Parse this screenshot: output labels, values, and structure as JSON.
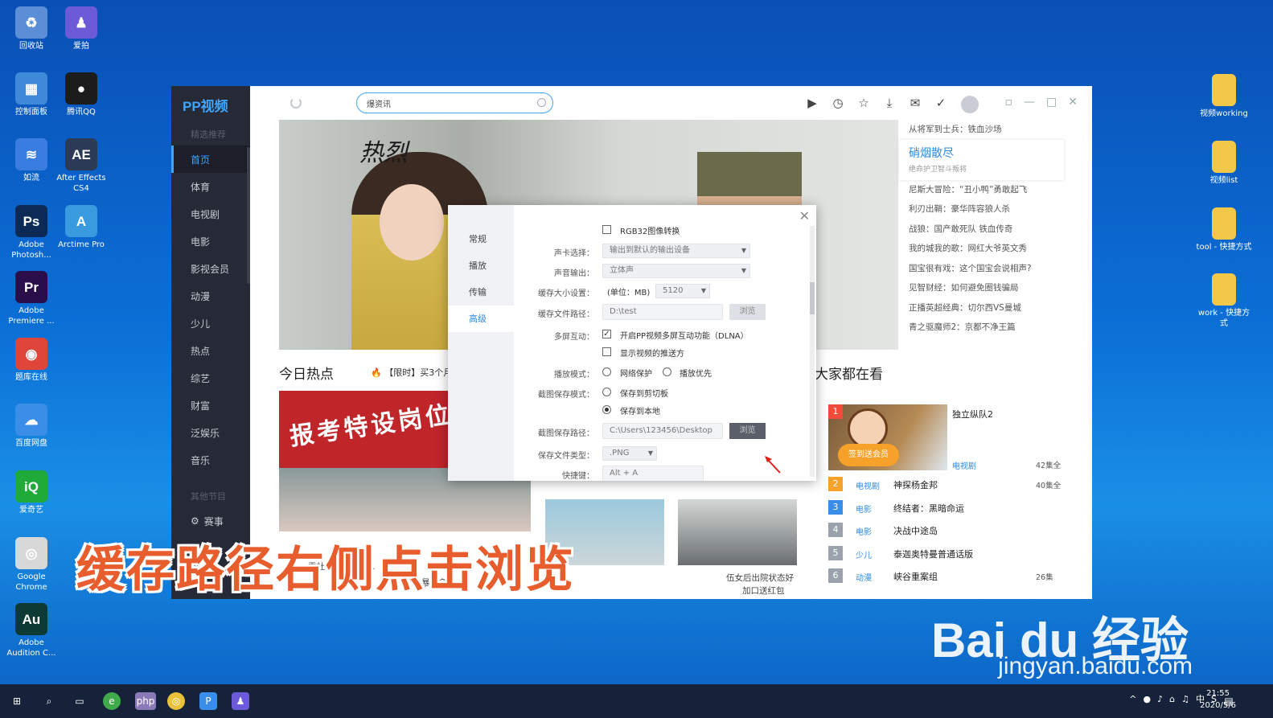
{
  "desktop": {
    "left_icons": [
      {
        "label": "回收站",
        "icon": "recycle-bin-icon",
        "color": "#5a8fd8",
        "glyph": "♻"
      },
      {
        "label": "爱拍",
        "icon": "aipai-icon",
        "color": "#6b5bd8",
        "glyph": "♟"
      },
      {
        "label": "控制面板",
        "icon": "control-panel-icon",
        "color": "#3f8ad8",
        "glyph": "▦"
      },
      {
        "label": "腾讯QQ",
        "icon": "qq-icon",
        "color": "#1c1c1c",
        "glyph": "●"
      },
      {
        "label": "如流",
        "icon": "ruliu-icon",
        "color": "#3a7de0",
        "glyph": "≋"
      },
      {
        "label": "After Effects CS4",
        "icon": "after-effects-icon",
        "color": "#2b3a55",
        "glyph": "AE"
      },
      {
        "label": "Adobe Photosh...",
        "icon": "photoshop-icon",
        "color": "#0c2a55",
        "glyph": "Ps"
      },
      {
        "label": "Arctime Pro",
        "icon": "arctime-icon",
        "color": "#3a9ae0",
        "glyph": "A"
      },
      {
        "label": "Adobe Premiere ...",
        "icon": "premiere-icon",
        "color": "#2a0e4a",
        "glyph": "Pr"
      },
      {
        "label": "题库在线",
        "icon": "tiku-icon",
        "color": "#e0453a",
        "glyph": "◉"
      },
      {
        "label": "百度网盘",
        "icon": "baidu-netdisk-icon",
        "color": "#3a8ee8",
        "glyph": "☁"
      },
      {
        "label": "爱奇艺",
        "icon": "iqiyi-icon",
        "color": "#1faa3a",
        "glyph": "iQ"
      },
      {
        "label": "Google Chrome",
        "icon": "chrome-icon",
        "color": "#d8d8d8",
        "glyph": "◎"
      },
      {
        "label": "Adobe Audition C...",
        "icon": "audition-icon",
        "color": "#0d3a35",
        "glyph": "Au"
      }
    ],
    "right_icons": [
      {
        "label": "视频working",
        "icon": "folder-icon"
      },
      {
        "label": "视频list",
        "icon": "folder-icon"
      },
      {
        "label": "tool - 快捷方式",
        "icon": "folder-shortcut-icon"
      },
      {
        "label": "work - 快捷方式",
        "icon": "folder-shortcut-icon"
      }
    ]
  },
  "app": {
    "logo": "PP视频",
    "nav_section_top": "精选推荐",
    "nav_items": [
      "首页",
      "体育",
      "电视剧",
      "电影",
      "影视会员",
      "动漫",
      "少儿",
      "热点",
      "综艺",
      "财富",
      "泛娱乐",
      "音乐"
    ],
    "nav_section_bottom": "其他节目",
    "nav_bottom_item": "赛事",
    "search_value": "爆资讯",
    "hero_title": "热烈",
    "hot_list": [
      {
        "text": "从将军到士兵：铁血沙场"
      },
      {
        "featured": true,
        "title": "硝烟散尽",
        "sub": "绝命护卫智斗叛将"
      },
      {
        "text": "尼斯大冒险：“丑小鸭”勇敢起飞"
      },
      {
        "text": "利刃出鞘：豪华阵容狼人杀"
      },
      {
        "text": "战狼：国产敢死队 铁血传奇"
      },
      {
        "text": "我的城我的歌：网红大爷英文秀"
      },
      {
        "text": "国宝很有戏：这个国宝会说相声?"
      },
      {
        "text": "见智财经：如何避免圈钱骗局"
      },
      {
        "text": "正播英超经典：切尔西VS曼城"
      },
      {
        "text": "青之驱魔师2：京都不净王篇"
      }
    ],
    "today_hot": "今日热点",
    "promo": "【限时】买3个月",
    "banner_text": "报考特设岗位教",
    "captions": [
      "霍杜上门鱼苗被...",
      "赢风暴，多方...",
      "伍女后出院状态好",
      "加口送红包"
    ],
    "everyone_watching": "大家都在看",
    "ranking": [
      {
        "num": "1",
        "cat": "电视剧",
        "name": "独立纵队2",
        "ep": "42集全",
        "color": "#f24b3a"
      },
      {
        "num": "2",
        "cat": "电视剧",
        "name": "神探杨金邦",
        "ep": "40集全",
        "color": "#f5a12a"
      },
      {
        "num": "3",
        "cat": "电影",
        "name": "终结者：黑暗命运",
        "ep": "",
        "color": "#3a8ee8"
      },
      {
        "num": "4",
        "cat": "电影",
        "name": "决战中途岛",
        "ep": "",
        "color": "#9aa3ad"
      },
      {
        "num": "5",
        "cat": "少儿",
        "name": "泰迦奥特曼普通话版",
        "ep": "",
        "color": "#9aa3ad"
      },
      {
        "num": "6",
        "cat": "动漫",
        "name": "峡谷重案组",
        "ep": "26集",
        "color": "#9aa3ad"
      }
    ],
    "signin": "签到送会员"
  },
  "dialog": {
    "tabs": [
      "常规",
      "播放",
      "传输",
      "高级"
    ],
    "active_tab": 3,
    "rgb32": "RGB32图像转换",
    "sound_card_label": "声卡选择：",
    "sound_card_value": "输出到默认的输出设备",
    "sound_output_label": "声音输出：",
    "sound_output_value": "立体声",
    "cache_size_label": "缓存大小设置：",
    "cache_size_unit": "(单位：MB)",
    "cache_size_value": "5120",
    "cache_path_label": "缓存文件路径：",
    "cache_path_value": "D:\\test",
    "browse": "浏览",
    "multiscreen_label": "多屏互动：",
    "dlna": "开启PP视频多屏互动功能（DLNA）",
    "show_push": "显示视频的推送方",
    "play_mode_label": "播放模式：",
    "net_protect": "网络保护",
    "play_first": "播放优先",
    "screenshot_mode_label": "截图保存模式：",
    "save_clipboard": "保存到剪切板",
    "save_local": "保存到本地",
    "screenshot_path_label": "截图保存路径：",
    "screenshot_path_value": "C:\\Users\\123456\\Desktop",
    "file_type_label": "保存文件类型：",
    "file_type_value": ".PNG",
    "shortcut_label": "快捷键：",
    "shortcut_value": "Alt + A"
  },
  "overlay_caption": "缓存路径右侧点击浏览",
  "watermark": {
    "brand": "Bai du 经验",
    "url": "jingyan.baidu.com"
  },
  "taskbar": {
    "time": "21:55",
    "date": "2020/5/6",
    "ime": "中"
  }
}
